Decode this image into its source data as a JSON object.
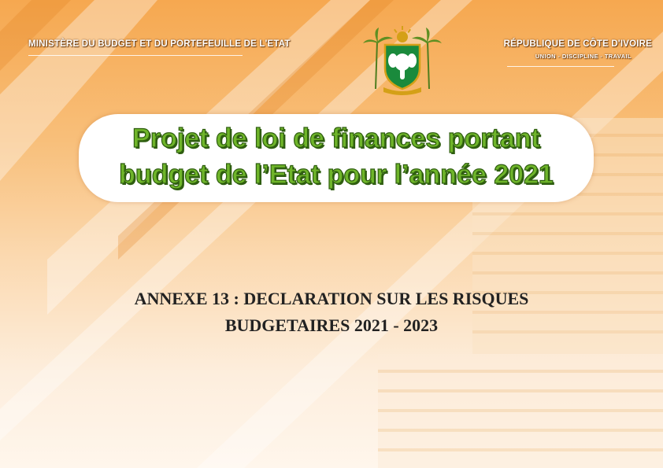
{
  "header": {
    "ministry": "MINISTÈRE DU BUDGET ET DU PORTEFEUILLE DE L'ETAT",
    "republic": "RÉPUBLIQUE DE CÔTE D'IVOIRE",
    "motto": "UNION - DISCIPLINE - TRAVAIL"
  },
  "emblem": {
    "icon": "coat-of-arms-icon",
    "colors": {
      "shield": "#1a8a3c",
      "sun": "#d4a017",
      "palm": "#4f7d1e"
    }
  },
  "title": {
    "line1": "Projet de loi de finances portant",
    "line2": "budget de l’Etat pour l’année 2021",
    "color": "#6fb52a"
  },
  "annex": {
    "line1": "ANNEXE 13 : DECLARATION SUR LES RISQUES",
    "line2": "BUDGETAIRES 2021 - 2023"
  }
}
